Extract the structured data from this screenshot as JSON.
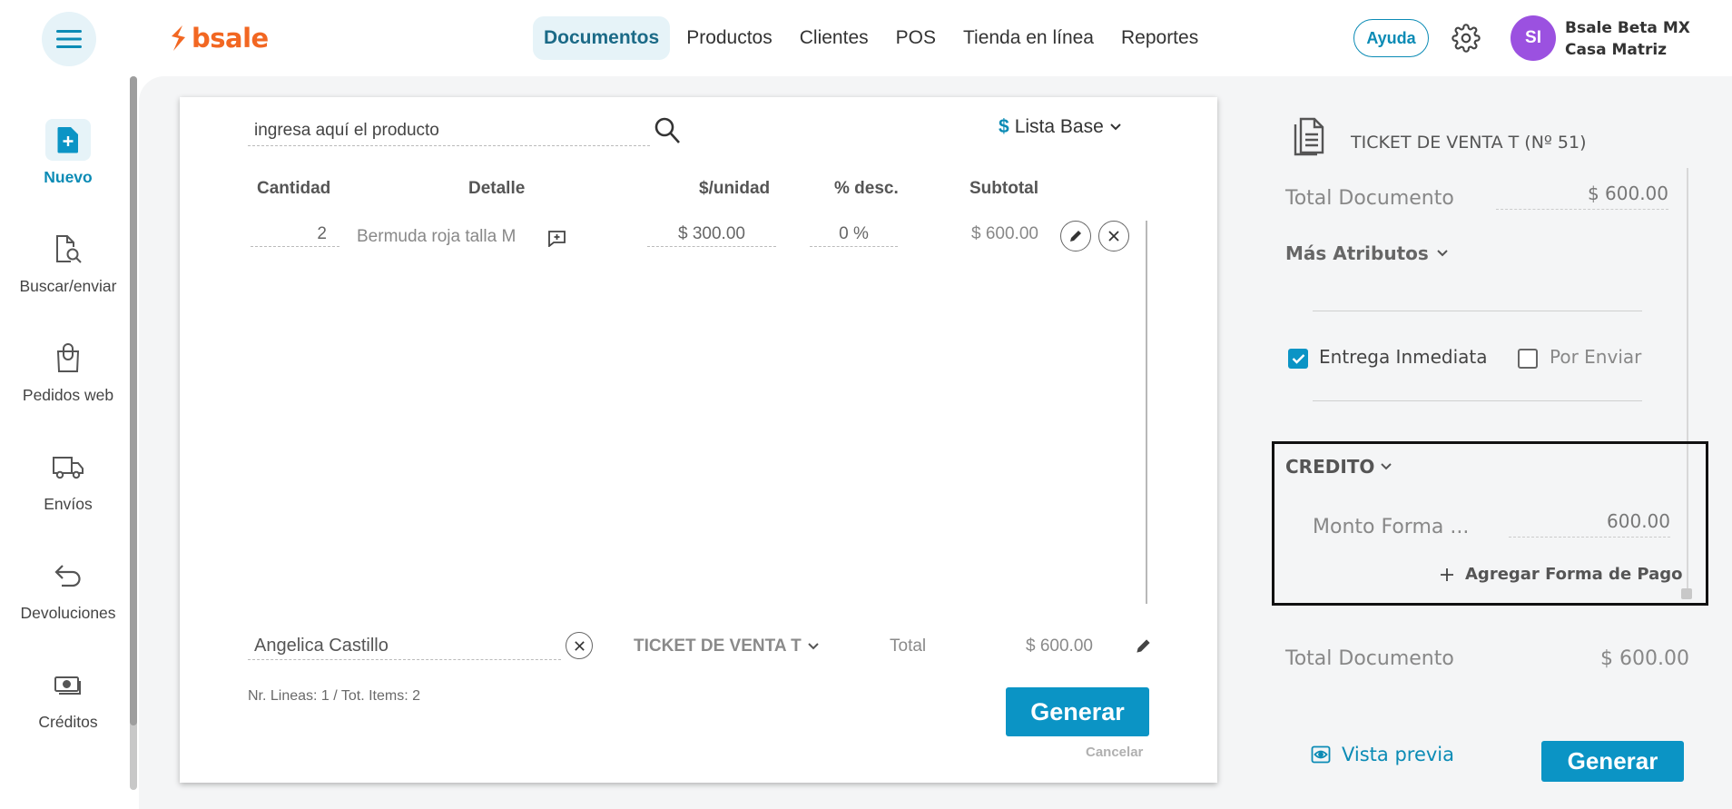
{
  "brand": {
    "name": "bsale",
    "color": "#f26722",
    "accent": "#0b94c5"
  },
  "nav": [
    {
      "label": "Documentos",
      "active": true
    },
    {
      "label": "Productos"
    },
    {
      "label": "Clientes"
    },
    {
      "label": "POS"
    },
    {
      "label": "Tienda en línea"
    },
    {
      "label": "Reportes"
    }
  ],
  "header": {
    "help_label": "Ayuda",
    "avatar_initials": "SI",
    "company_name": "Bsale Beta MX",
    "branch": "Casa Matriz"
  },
  "sidebar": [
    {
      "label": "Nuevo",
      "icon": "new-document-icon",
      "active": true
    },
    {
      "label": "Buscar/enviar",
      "icon": "search-document-icon"
    },
    {
      "label": "Pedidos web",
      "icon": "shopping-bag-icon"
    },
    {
      "label": "Envíos",
      "icon": "truck-icon"
    },
    {
      "label": "Devoluciones",
      "icon": "return-arrow-icon"
    },
    {
      "label": "Créditos",
      "icon": "credit-cash-icon"
    }
  ],
  "document": {
    "product_placeholder": "ingresa aquí el producto",
    "price_list_symbol": "$",
    "price_list": "Lista Base",
    "columns": {
      "qty": "Cantidad",
      "detail": "Detalle",
      "unit_price": "$/unidad",
      "discount": "% desc.",
      "subtotal": "Subtotal"
    },
    "lines": [
      {
        "qty": "2",
        "detail": "Bermuda roja talla M",
        "unit_price": "$ 300.00",
        "discount": "0 %",
        "subtotal": "$ 600.00"
      }
    ],
    "client": "Angelica Castillo",
    "doc_type": "TICKET DE VENTA T",
    "total_label": "Total",
    "total_value": "$ 600.00",
    "lines_info": "Nr. Lineas: 1 / Tot. Items: 2",
    "generate_label": "Generar",
    "cancel_label": "Cancelar"
  },
  "summary": {
    "ticket_title": "TICKET DE VENTA T (Nº 51)",
    "total_doc_label": "Total Documento",
    "total_doc_value": "$ 600.00",
    "more_attrs": "Más Atributos",
    "immediate_label": "Entrega Inmediata",
    "immediate_checked": true,
    "send_label": "Por Enviar",
    "send_checked": false,
    "payment_method": "CREDITO",
    "amount_label": "Monto Forma ...",
    "amount_value": "600.00",
    "add_payment": "Agregar Forma de Pago",
    "total_doc_label2": "Total Documento",
    "total_doc_value2": "$ 600.00",
    "preview_label": "Vista previa",
    "generate_label": "Generar"
  }
}
